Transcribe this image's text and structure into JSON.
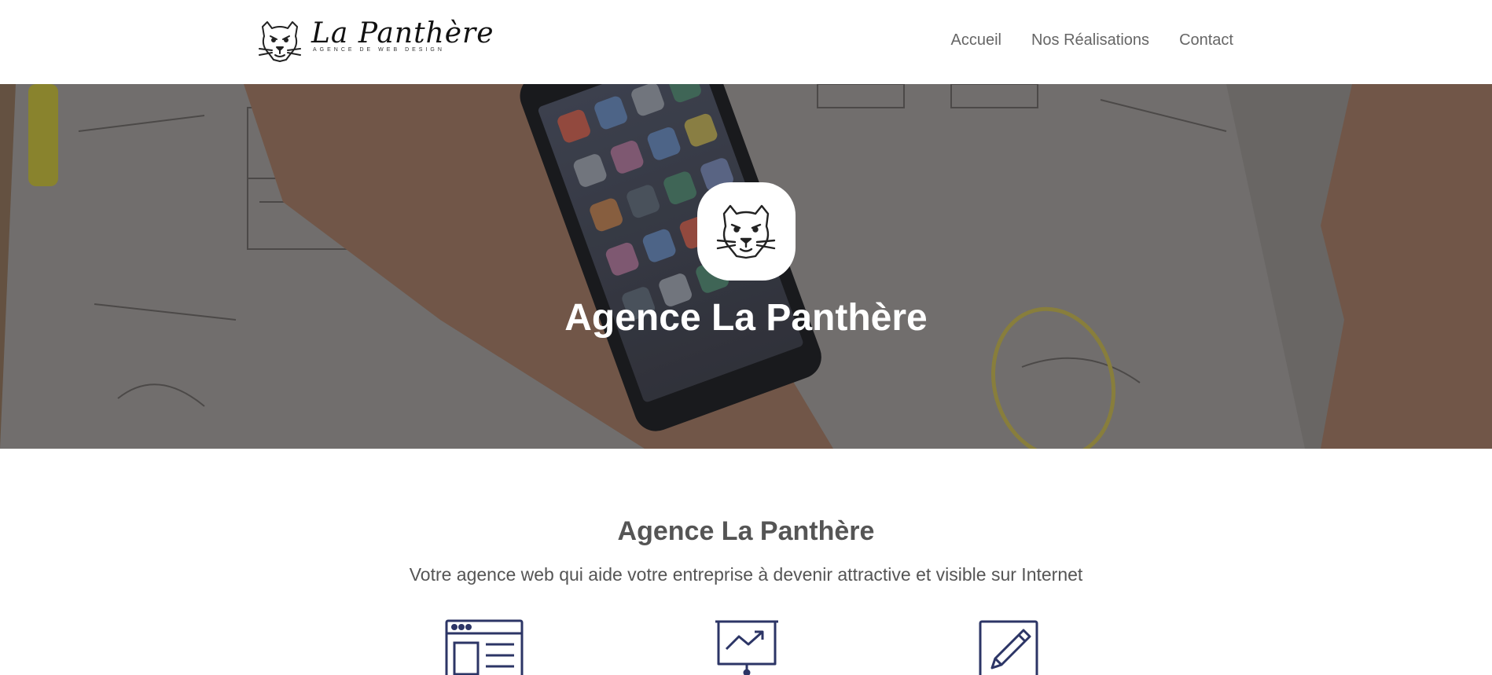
{
  "brand": {
    "name": "La Panthère",
    "tagline": "AGENCE DE WEB DESIGN",
    "logo_icon": "panther-head-icon"
  },
  "nav": {
    "items": [
      {
        "label": "Accueil"
      },
      {
        "label": "Nos Réalisations"
      },
      {
        "label": "Contact"
      }
    ]
  },
  "hero": {
    "title": "Agence La Panthère",
    "badge_icon": "panther-head-icon",
    "background": "desk-with-smartphone-and-wireframe-sketches"
  },
  "intro": {
    "title": "Agence La Panthère",
    "subtitle": "Votre agence web qui aide votre entreprise à devenir attractive et visible sur Internet"
  },
  "features": [
    {
      "icon": "web-layout-icon"
    },
    {
      "icon": "presentation-chart-icon"
    },
    {
      "icon": "pencil-edit-icon"
    }
  ],
  "colors": {
    "icon_navy": "#2c3566",
    "text_gray": "#555555",
    "nav_gray": "#666666"
  }
}
